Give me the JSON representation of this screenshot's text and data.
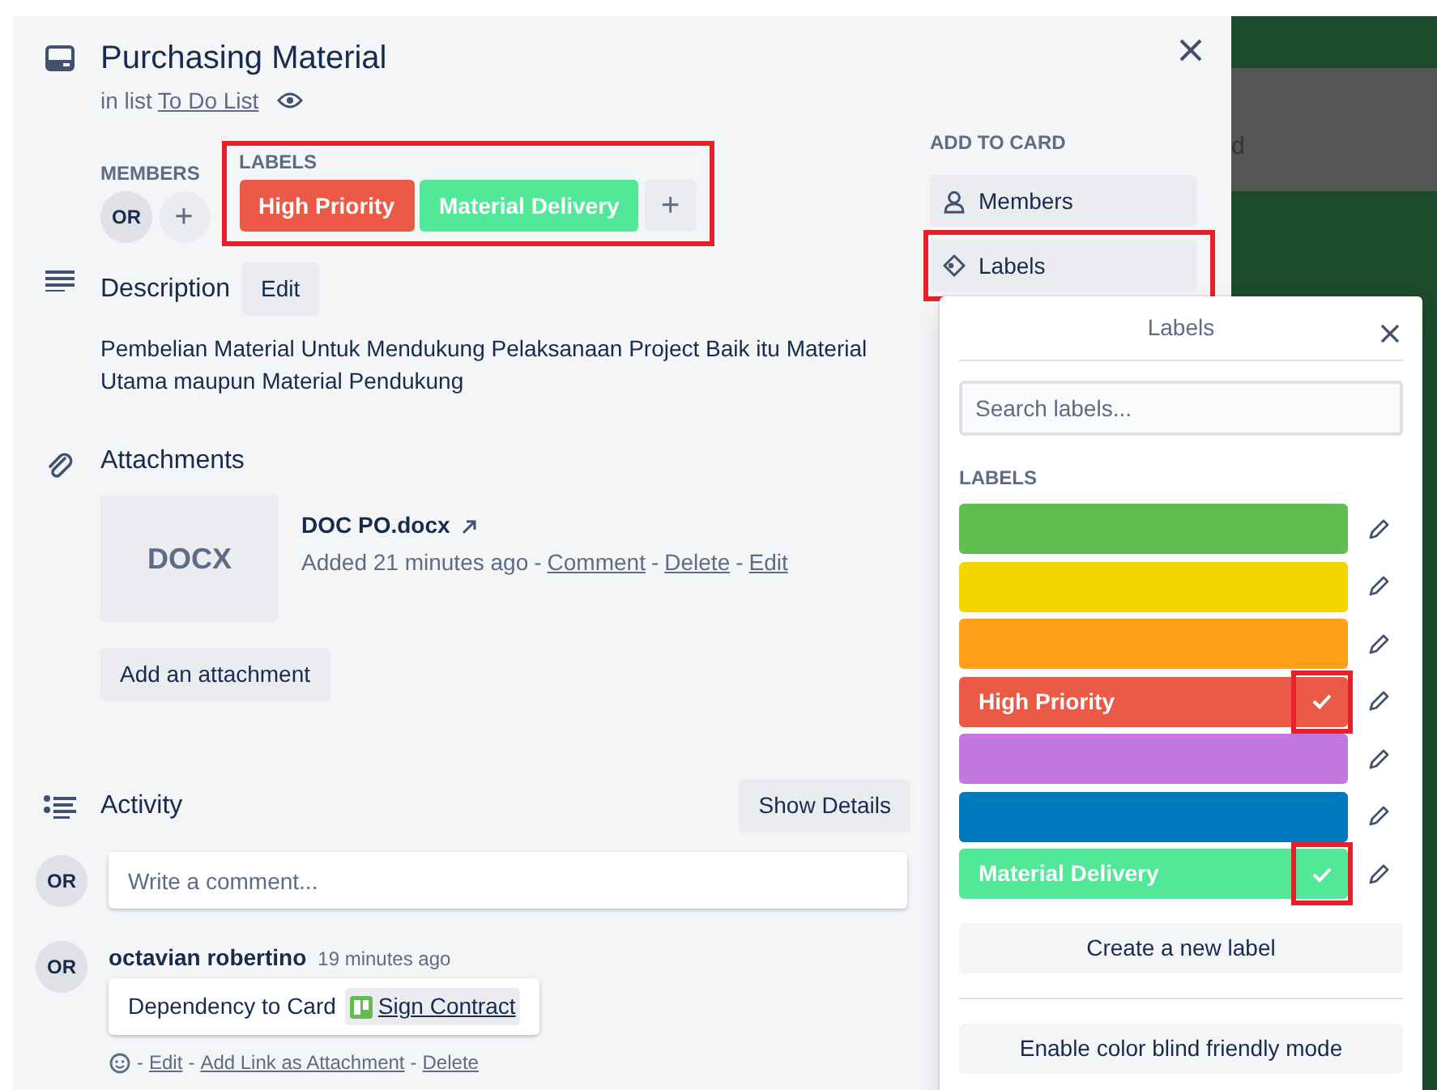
{
  "card": {
    "title": "Purchasing Material",
    "list_prefix": "in list",
    "list_name": "To Do List"
  },
  "members": {
    "heading": "MEMBERS",
    "avatars": [
      "OR"
    ],
    "add": "+"
  },
  "labels": {
    "heading": "LABELS",
    "highlighted": true,
    "add": "+",
    "items": [
      {
        "text": "High Priority",
        "color": "#eb5a46"
      },
      {
        "text": "Material Delivery",
        "color": "#51e898"
      }
    ]
  },
  "description": {
    "heading": "Description",
    "edit": "Edit",
    "text": "Pembelian Material Untuk Mendukung Pelaksanaan Project Baik itu Material Utama maupun Material Pendukung"
  },
  "attachments": {
    "heading": "Attachments",
    "add_button": "Add an attachment",
    "items": [
      {
        "thumb": "DOCX",
        "name": "DOC PO.docx",
        "added": "Added 21 minutes ago",
        "separator": "-",
        "actions": [
          "Comment",
          "Delete",
          "Edit"
        ]
      }
    ]
  },
  "activity": {
    "heading": "Activity",
    "show_details": "Show Details",
    "avatar": "OR",
    "comment_placeholder": "Write a comment...",
    "entries": [
      {
        "avatar": "OR",
        "author": "octavian robertino",
        "time": "19 minutes ago",
        "text": "Dependency to Card",
        "link": "Sign Contract",
        "separator": "-",
        "actions": [
          "Edit",
          "Add Link as Attachment",
          "Delete"
        ]
      }
    ]
  },
  "sidebar": {
    "heading": "ADD TO CARD",
    "buttons": [
      {
        "kind": "members",
        "label": "Members",
        "highlighted": false
      },
      {
        "kind": "labels",
        "label": "Labels",
        "highlighted": true
      }
    ]
  },
  "background_card": {
    "text": "d"
  },
  "popover": {
    "title": "Labels",
    "search_placeholder": "Search labels...",
    "heading": "LABELS",
    "create_button": "Create a new label",
    "colorblind_button": "Enable color blind friendly mode",
    "labels": [
      {
        "color": "#61bd4f",
        "checked": false,
        "highlighted": false
      },
      {
        "color": "#f2d600",
        "checked": false,
        "highlighted": false
      },
      {
        "color": "#ff9f1a",
        "checked": false,
        "highlighted": false
      },
      {
        "color": "#eb5a46",
        "text": "High Priority",
        "checked": true,
        "highlighted": true
      },
      {
        "color": "#c377e0",
        "checked": false,
        "highlighted": false
      },
      {
        "color": "#0079bf",
        "checked": false,
        "highlighted": false
      },
      {
        "color": "#51e898",
        "text": "Material Delivery",
        "checked": true,
        "highlighted": true
      }
    ]
  }
}
